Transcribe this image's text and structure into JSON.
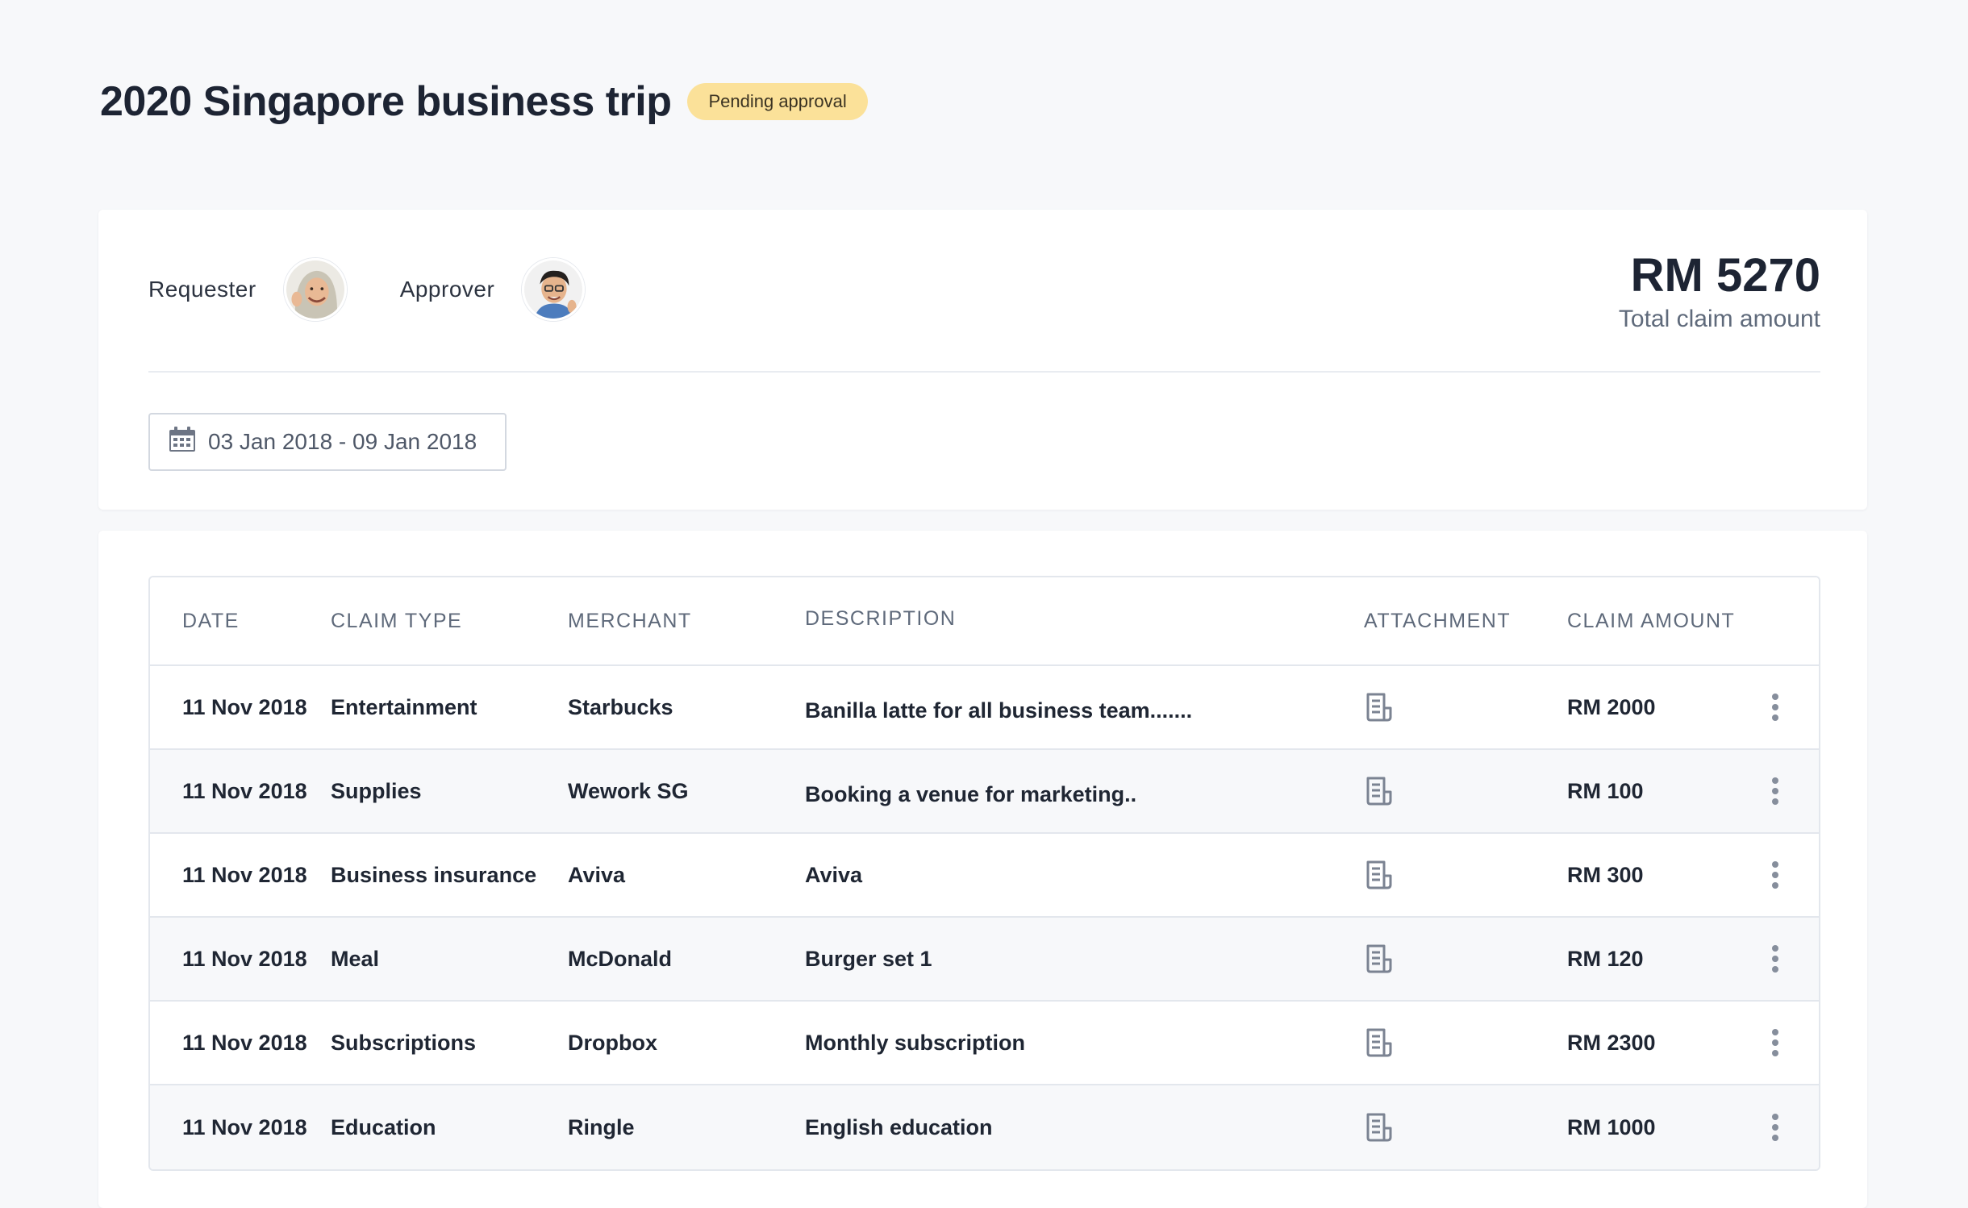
{
  "header": {
    "title": "2020 Singapore business trip",
    "status": "Pending approval"
  },
  "summary": {
    "requester_label": "Requester",
    "approver_label": "Approver",
    "total_amount": "RM 5270",
    "total_label": "Total claim amount",
    "date_range": "03 Jan 2018 - 09 Jan 2018",
    "icons": {
      "date": "calendar-icon"
    }
  },
  "table": {
    "columns": [
      "DATE",
      "CLAIM TYPE",
      "MERCHANT",
      "DESCRIPTION",
      "ATTACHMENT",
      "CLAIM AMOUNT"
    ],
    "rows": [
      {
        "date": "11 Nov 2018",
        "type": "Entertainment",
        "merchant": "Starbucks",
        "description": "Banilla latte for all business team.......",
        "amount": "RM 2000"
      },
      {
        "date": "11 Nov 2018",
        "type": "Supplies",
        "merchant": "Wework SG",
        "description": "Booking a venue for marketing..",
        "amount": "RM 100"
      },
      {
        "date": "11 Nov 2018",
        "type": "Business insurance",
        "merchant": "Aviva",
        "description": "Aviva",
        "amount": "RM 300"
      },
      {
        "date": "11 Nov 2018",
        "type": "Meal",
        "merchant": "McDonald",
        "description": "Burger set 1",
        "amount": "RM 120"
      },
      {
        "date": "11 Nov 2018",
        "type": "Subscriptions",
        "merchant": "Dropbox",
        "description": "Monthly subscription",
        "amount": "RM 2300"
      },
      {
        "date": "11 Nov 2018",
        "type": "Education",
        "merchant": "Ringle",
        "description": "English education",
        "amount": "RM 1000"
      }
    ],
    "icons": {
      "attachment": "receipt-icon",
      "actions": "more-vertical-icon"
    }
  },
  "colors": {
    "badge_bg": "#fbe199",
    "page_bg": "#f7f8fa",
    "muted_text": "#5f6a7b"
  }
}
